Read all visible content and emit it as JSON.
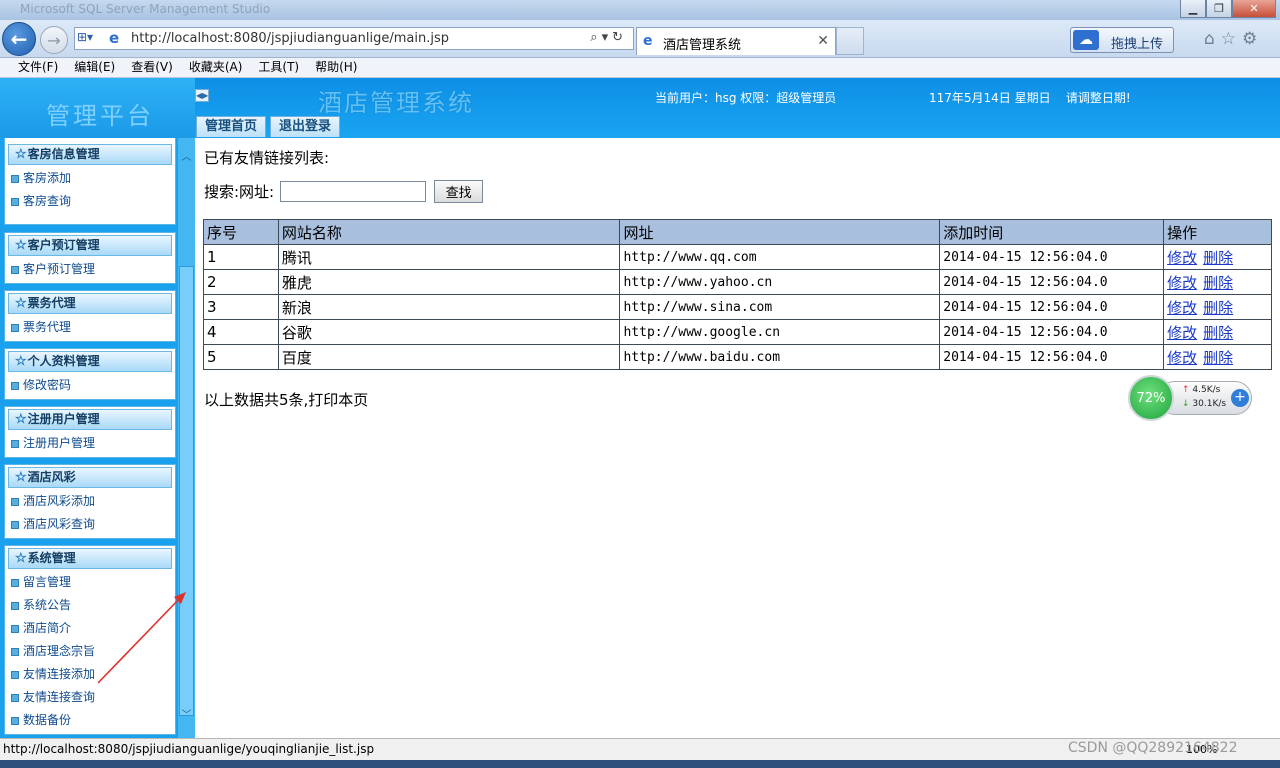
{
  "browser": {
    "window_title": "Microsoft SQL Server Management Studio",
    "address_url": "http://localhost:8080/jspjiudianguanlige/main.jsp",
    "tab_title": "酒店管理系统",
    "baidu_button": "拖拽上传",
    "menus": [
      "文件(F)",
      "编辑(E)",
      "查看(V)",
      "收藏夹(A)",
      "工具(T)",
      "帮助(H)"
    ],
    "status_url": "http://localhost:8080/jspjiudianguanlige/youqinglianjie_list.jsp",
    "zoom": "100%"
  },
  "header": {
    "brand": "管理平台",
    "system_title": "酒店管理系统",
    "user_info": "当前用户：hsg 权限：超级管理员",
    "date_info": "117年5月14日 星期日    请调整日期!",
    "tabs": [
      "管理首页",
      "退出登录"
    ]
  },
  "sidebar": {
    "panels": [
      {
        "title": "客房信息管理",
        "items": [
          "客房添加",
          "客房查询"
        ]
      },
      {
        "title": "客户预订管理",
        "items": [
          "客户预订管理"
        ]
      },
      {
        "title": "票务代理",
        "items": [
          "票务代理"
        ]
      },
      {
        "title": "个人资料管理",
        "items": [
          "修改密码"
        ]
      },
      {
        "title": "注册用户管理",
        "items": [
          "注册用户管理"
        ]
      },
      {
        "title": "酒店风彩",
        "items": [
          "酒店风彩添加",
          "酒店风彩查询"
        ]
      },
      {
        "title": "系统管理",
        "items": [
          "留言管理",
          "系统公告",
          "酒店简介",
          "酒店理念宗旨",
          "友情连接添加",
          "友情连接查询",
          "数据备份"
        ]
      }
    ]
  },
  "main": {
    "list_title": "已有友情链接列表:",
    "search_label": "搜索:网址:",
    "search_value": "",
    "search_button": "查找",
    "columns": [
      "序号",
      "网站名称",
      "网址",
      "添加时间",
      "操作"
    ],
    "rows": [
      {
        "id": "1",
        "name": "腾讯",
        "url": "http://www.qq.com",
        "time": "2014-04-15 12:56:04.0"
      },
      {
        "id": "2",
        "name": "雅虎",
        "url": "http://www.yahoo.cn",
        "time": "2014-04-15 12:56:04.0"
      },
      {
        "id": "3",
        "name": "新浪",
        "url": "http://www.sina.com",
        "time": "2014-04-15 12:56:04.0"
      },
      {
        "id": "4",
        "name": "谷歌",
        "url": "http://www.google.cn",
        "time": "2014-04-15 12:56:04.0"
      },
      {
        "id": "5",
        "name": "百度",
        "url": "http://www.baidu.com",
        "time": "2014-04-15 12:56:04.0"
      }
    ],
    "edit_label": "修改",
    "delete_label": "删除",
    "summary": "以上数据共5条,打印本页"
  },
  "net_widget": {
    "percent": "72%",
    "up": "4.5K/s",
    "down": "30.1K/s"
  },
  "watermark": "CSDN @QQ2892164822"
}
